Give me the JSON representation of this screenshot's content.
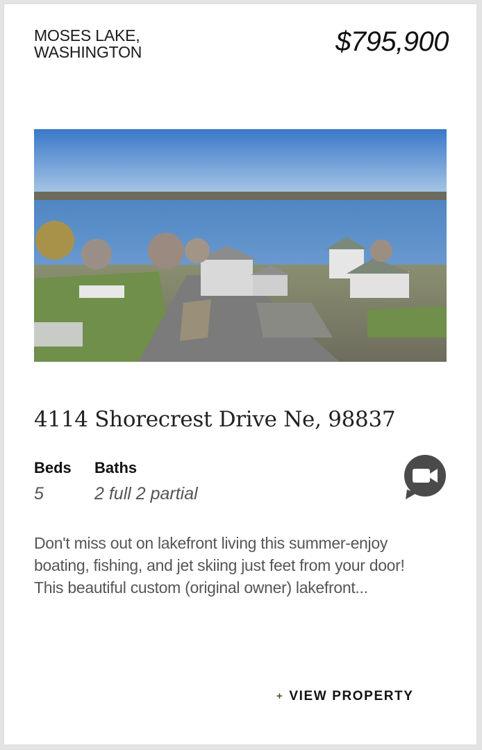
{
  "listing": {
    "location_line1": "MOSES LAKE,",
    "location_line2": "WASHINGTON",
    "price": "$795,900",
    "photo_alt": "Aerial view of lakefront home",
    "address": "4114 Shorecrest Drive Ne, 98837",
    "beds_label": "Beds",
    "beds_value": "5",
    "baths_label": "Baths",
    "baths_value": "2 full 2 partial",
    "video_icon": "video-camera-icon",
    "description_lines": [
      "Don't miss out on lakefront living this summer-enjoy",
      "boating, fishing, and jet skiing just feet from your door!",
      "This beautiful custom (original owner) lakefront..."
    ],
    "cta_plus": "+",
    "cta_label": "VIEW PROPERTY"
  },
  "colors": {
    "cta_plus": "#3f5e2a",
    "video_icon_bg": "#4a4a4a",
    "text_primary": "#111111",
    "text_muted": "#555555"
  }
}
